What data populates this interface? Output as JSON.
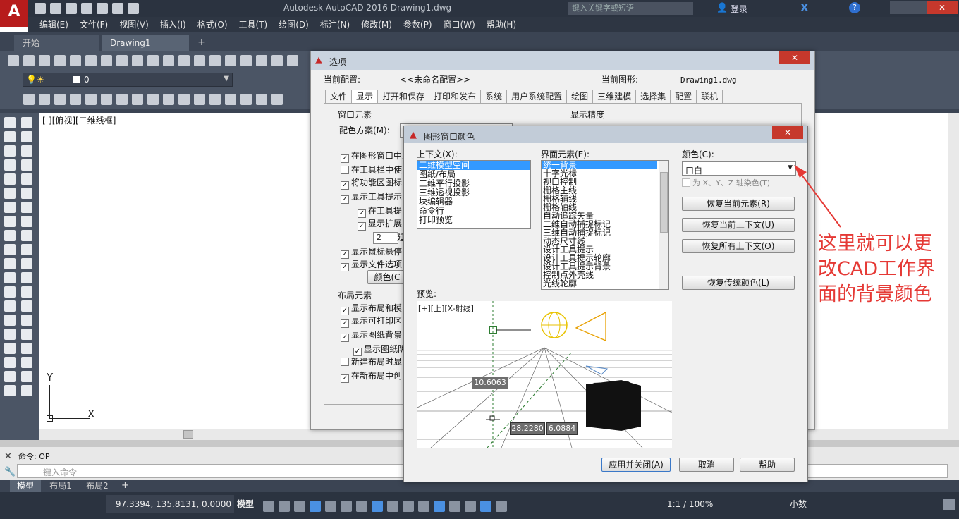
{
  "app": {
    "title": "Autodesk AutoCAD 2016 Drawing1.dwg",
    "search_placeholder": "键入关键字或短语",
    "login": "登录"
  },
  "menu": [
    "编辑(E)",
    "文件(F)",
    "视图(V)",
    "插入(I)",
    "格式(O)",
    "工具(T)",
    "绘图(D)",
    "标注(N)",
    "修改(M)",
    "参数(P)",
    "窗口(W)",
    "帮助(H)"
  ],
  "doc_tabs": [
    "开始",
    "Drawing1"
  ],
  "layer": {
    "name": "0"
  },
  "viewport": {
    "label": "[-][俯视][二维线框]"
  },
  "ucs": {
    "x": "X",
    "y": "Y"
  },
  "command": {
    "history": "命令: OP",
    "placeholder": "键入命令"
  },
  "layout_tabs": [
    "模型",
    "布局1",
    "布局2"
  ],
  "status": {
    "coords": "97.3394, 135.8131, 0.0000",
    "model": "模型",
    "scale": "1:1 / 100%",
    "units": "小数"
  },
  "options": {
    "title": "选项",
    "current_profile_label": "当前配置:",
    "current_profile": "<<未命名配置>>",
    "current_drawing_label": "当前图形:",
    "current_drawing": "Drawing1.dwg",
    "tabs": [
      "文件",
      "显示",
      "打开和保存",
      "打印和发布",
      "系统",
      "用户系统配置",
      "绘图",
      "三维建模",
      "选择集",
      "配置",
      "联机"
    ],
    "window_elements": "窗口元素",
    "color_scheme_label": "配色方案(M):",
    "checks": [
      "在图形窗口中显",
      "在工具栏中使",
      "将功能区图标",
      "显示工具提示",
      "在工具提",
      "显示扩展",
      "显示鼠标悬停",
      "显示文件选项"
    ],
    "delay_value": "2",
    "delay_label": "延",
    "colors_button": "颜色(C",
    "layout_elements": "布局元素",
    "layout_checks": [
      "显示布局和模",
      "显示可打印区",
      "显示图纸背景",
      "显示图纸阴",
      "新建布局时显",
      "在新布局中创"
    ],
    "display_precision": "显示精度"
  },
  "colors_dialog": {
    "title": "图形窗口颜色",
    "context_label": "上下文(X):",
    "contexts": [
      "二维模型空间",
      "图纸/布局",
      "三维平行投影",
      "三维透视投影",
      "块编辑器",
      "命令行",
      "打印预览"
    ],
    "element_label": "界面元素(E):",
    "elements": [
      "统一背景",
      "十字光标",
      "视口控制",
      "栅格主线",
      "栅格辅线",
      "栅格轴线",
      "自动追踪矢量",
      "二维自动捕捉标记",
      "三维自动捕捉标记",
      "动态尺寸线",
      "设计工具提示",
      "设计工具提示轮廓",
      "设计工具提示背景",
      "控制点外壳线",
      "光线轮廓"
    ],
    "color_label": "颜色(C):",
    "color_value": "口白",
    "tint_label": "为 X、Y、Z 轴染色(T)",
    "restore_element": "恢复当前元素(R)",
    "restore_context": "恢复当前上下文(U)",
    "restore_all": "恢复所有上下文(O)",
    "restore_classic": "恢复传统颜色(L)",
    "preview_label": "预览:",
    "preview_viewport": "[+][上][X-射线]",
    "dims": [
      "10.6063",
      "28.2280",
      "6.0884"
    ],
    "apply": "应用并关闭(A)",
    "cancel": "取消",
    "help": "帮助"
  },
  "annotation": {
    "line1": "这里就可以更",
    "line2": "改CAD工作界",
    "line3": "面的背景颜色",
    "color": "#e53935"
  }
}
